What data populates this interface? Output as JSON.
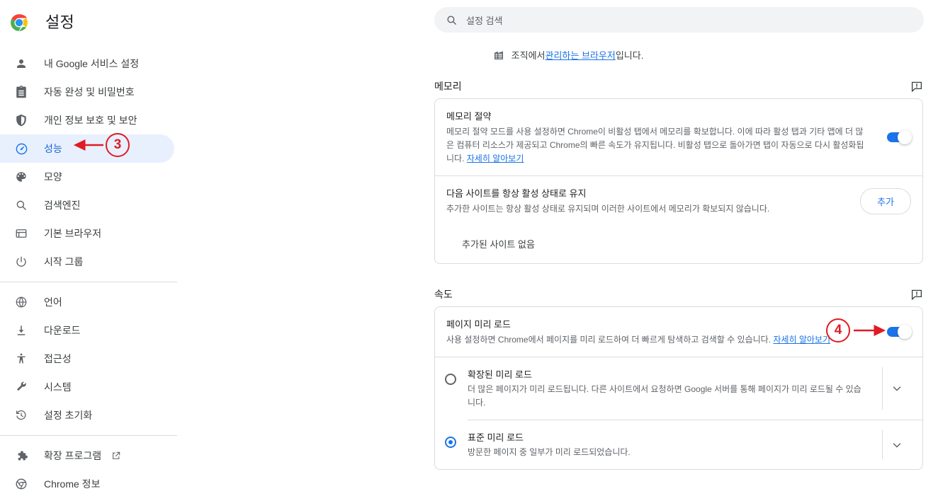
{
  "app": {
    "title": "설정",
    "logo_icon": "chrome-logo-icon"
  },
  "sidebar": {
    "items": [
      {
        "label": "내 Google 서비스 설정",
        "icon": "person-icon",
        "active": false
      },
      {
        "label": "자동 완성 및 비밀번호",
        "icon": "clipboard-icon",
        "active": false
      },
      {
        "label": "개인 정보 보호 및 보안",
        "icon": "shield-icon",
        "active": false
      },
      {
        "label": "성능",
        "icon": "speedometer-icon",
        "active": true
      },
      {
        "label": "모양",
        "icon": "palette-icon",
        "active": false
      },
      {
        "label": "검색엔진",
        "icon": "search-icon",
        "active": false
      },
      {
        "label": "기본 브라우저",
        "icon": "browser-window-icon",
        "active": false
      },
      {
        "label": "시작 그룹",
        "icon": "power-icon",
        "active": false
      },
      {
        "label": "언어",
        "icon": "globe-icon",
        "active": false
      },
      {
        "label": "다운로드",
        "icon": "download-icon",
        "active": false
      },
      {
        "label": "접근성",
        "icon": "accessibility-icon",
        "active": false
      },
      {
        "label": "시스템",
        "icon": "wrench-icon",
        "active": false
      },
      {
        "label": "설정 초기화",
        "icon": "history-restore-icon",
        "active": false
      },
      {
        "label": "확장 프로그램",
        "icon": "puzzle-icon",
        "active": false,
        "external": true,
        "external_icon": "open-in-new-icon"
      },
      {
        "label": "Chrome 정보",
        "icon": "chrome-outline-icon",
        "active": false
      }
    ]
  },
  "search": {
    "placeholder": "설정 검색",
    "icon": "search-icon",
    "value": ""
  },
  "managed_notice": {
    "icon": "organization-building-icon",
    "prefix": "조직에서 ",
    "link": "관리하는 브라우저",
    "suffix": "입니다."
  },
  "memory_section": {
    "title": "메모리",
    "feedback_icon": "feedback-exclamation-icon",
    "memory_saver": {
      "title": "메모리 절약",
      "desc": "메모리 절약 모드를 사용 설정하면 Chrome이 비활성 탭에서 메모리를 확보합니다. 이에 따라 활성 탭과 기타 앱에 더 많은 컴퓨터 리소스가 제공되고 Chrome의 빠른 속도가 유지됩니다. 비활성 탭으로 돌아가면 탭이 자동으로 다시 활성화됩니다. ",
      "link": "자세히 알아보기",
      "toggle_state": "on"
    },
    "always_active_sites": {
      "title": "다음 사이트를 항상 활성 상태로 유지",
      "desc": "추가한 사이트는 항상 활성 상태로 유지되며 이러한 사이트에서 메모리가 확보되지 않습니다.",
      "add_button": "추가",
      "empty_text": "추가된 사이트 없음"
    }
  },
  "speed_section": {
    "title": "속도",
    "feedback_icon": "feedback-exclamation-icon",
    "preload": {
      "title": "페이지 미리 로드",
      "desc": "사용 설정하면 Chrome에서 페이지를 미리 로드하여 더 빠르게 탐색하고 검색할 수 있습니다. ",
      "link": "자세히 알아보기",
      "toggle_state": "on"
    },
    "options": [
      {
        "title": "확장된 미리 로드",
        "desc": "더 많은 페이지가 미리 로드됩니다. 다른 사이트에서 요청하면 Google 서버를 통해 페이지가 미리 로드될 수 있습니다.",
        "selected": false,
        "expand_icon": "chevron-down-icon"
      },
      {
        "title": "표준 미리 로드",
        "desc": "방문한 페이지 중 일부가 미리 로드되었습니다.",
        "selected": true,
        "expand_icon": "chevron-down-icon"
      }
    ]
  },
  "annotations": {
    "color": "#e01b24",
    "markers": [
      {
        "number": "3",
        "target": "sidebar-item-성능"
      },
      {
        "number": "4",
        "target": "preload-toggle"
      }
    ]
  }
}
